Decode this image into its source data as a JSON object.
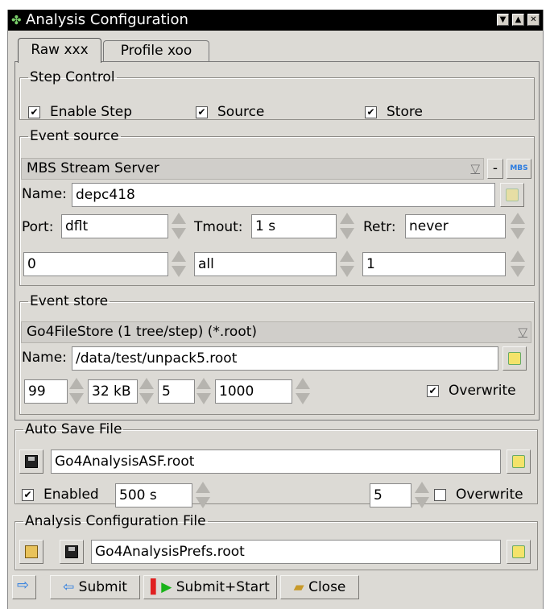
{
  "window": {
    "title": "Analysis Configuration",
    "app_icon": "go4-icon",
    "buttons": [
      "minimize",
      "maximize",
      "close"
    ]
  },
  "tabs": [
    {
      "label": "Raw xxx",
      "active": true
    },
    {
      "label": "Profile xoo",
      "active": false
    }
  ],
  "step_control": {
    "legend": "Step Control",
    "enable_step": {
      "label": "Enable Step",
      "checked": true
    },
    "source": {
      "label": "Source",
      "checked": true
    },
    "store": {
      "label": "Store",
      "checked": true
    }
  },
  "event_source": {
    "legend": "Event source",
    "type": "MBS Stream Server",
    "minus_label": "-",
    "mbs_label": "MBS",
    "name_label": "Name:",
    "name_value": "depc418",
    "port_label": "Port:",
    "port_value": "dflt",
    "tmout_label": "Tmout:",
    "tmout_value": "1 s",
    "retr_label": "Retr:",
    "retr_value": "never",
    "first_value": "0",
    "last_value": "all",
    "step_value": "1"
  },
  "event_store": {
    "legend": "Event store",
    "type": "Go4FileStore (1 tree/step) (*.root)",
    "name_label": "Name:",
    "name_value": "/data/test/unpack5.root",
    "split_value": "99",
    "buffer_value": "32 kB",
    "compression_value": "5",
    "autosave_value": "1000",
    "overwrite_label": "Overwrite",
    "overwrite_checked": true
  },
  "auto_save": {
    "legend": "Auto Save File",
    "file_name": "Go4AnalysisASF.root",
    "enabled_label": "Enabled",
    "enabled_checked": true,
    "interval_value": "500 s",
    "compression_value": "5",
    "overwrite_label": "Overwrite",
    "overwrite_checked": false
  },
  "config_file": {
    "legend": "Analysis Configuration File",
    "file_name": "Go4AnalysisPrefs.root"
  },
  "bottom_buttons": {
    "submit_label": "Submit",
    "submit_start_label": "Submit+Start",
    "close_label": "Close"
  },
  "colors": {
    "titlebar": "#000000",
    "dialog_bg": "#dcdad5",
    "field_bg": "#ffffff",
    "arrow_blue": "#2a7be0"
  }
}
